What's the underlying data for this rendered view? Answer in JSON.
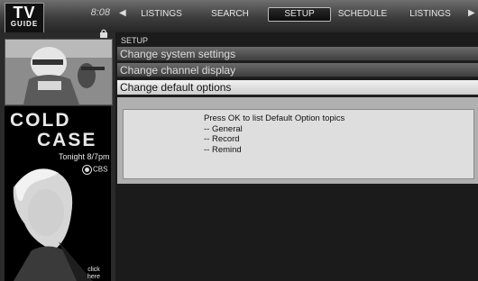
{
  "header": {
    "logo_line1": "TV",
    "logo_line2": "GUIDE",
    "time": "8:08",
    "left_arrow": "◀",
    "right_arrow": "▶",
    "tabs": [
      {
        "label": "LISTINGS"
      },
      {
        "label": "SEARCH"
      },
      {
        "label": "SETUP",
        "selected": true
      },
      {
        "label": "SCHEDULE"
      },
      {
        "label": "LISTINGS"
      }
    ]
  },
  "sidebar": {
    "ad": {
      "title_line1": "COLD",
      "title_line2": "CASE",
      "airtime": "Tonight 8/7pm",
      "network": "CBS",
      "cta_line1": "click",
      "cta_line2": "here"
    }
  },
  "main": {
    "breadcrumb": "SETUP",
    "menu": [
      {
        "label": "Change system settings"
      },
      {
        "label": "Change channel display"
      },
      {
        "label": "Change default options",
        "selected": true
      }
    ],
    "info": {
      "lines": [
        "Press OK to list Default Option topics",
        "-- General",
        "-- Record",
        "-- Remind"
      ]
    }
  },
  "icons": {
    "lock": "lock-icon",
    "cbs": "cbs-eye-icon"
  }
}
